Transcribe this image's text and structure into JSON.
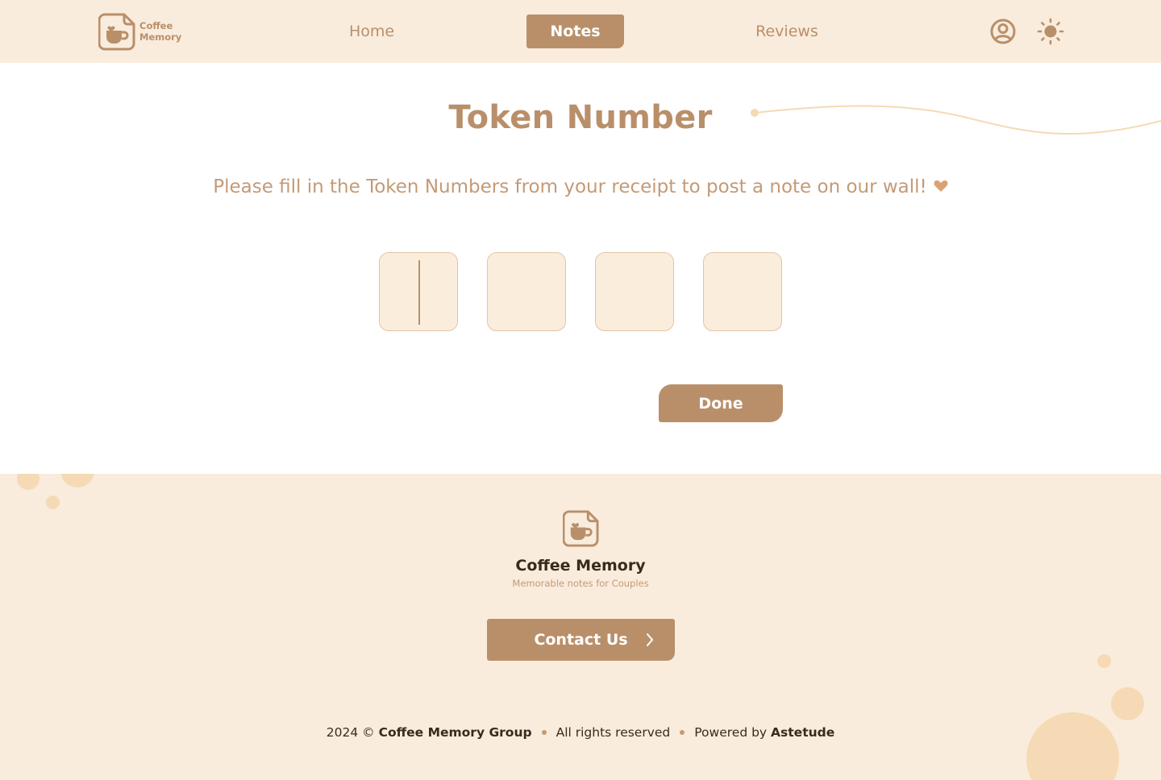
{
  "brand": {
    "name_line1": "Coffee",
    "name_line2": "Memory",
    "full_name": "Coffee Memory",
    "tagline": "Memorable notes for Couples"
  },
  "nav": {
    "items": [
      {
        "label": "Home",
        "active": false
      },
      {
        "label": "Notes",
        "active": true
      },
      {
        "label": "Reviews",
        "active": false
      }
    ],
    "icons": [
      "user-icon",
      "sun-icon"
    ]
  },
  "main": {
    "title": "Token Number",
    "subtitle": "Please fill in the Token Numbers from your receipt to post a note on our wall!",
    "subtitle_icon": "heart-icon",
    "token_inputs": [
      "",
      "",
      "",
      ""
    ],
    "done_label": "Done"
  },
  "footer": {
    "contact_label": "Contact Us",
    "contact_icon": "chevron-right-icon",
    "year": "2024 ©",
    "group": "Coffee Memory Group",
    "rights": "All rights reserved",
    "powered_prefix": "Powered by",
    "powered_by": "Astetude"
  },
  "colors": {
    "accent": "#b98f6a",
    "background_tint": "#f9ecdc",
    "token_box": "#fbeddc",
    "circle": "#f5dab5",
    "heading_dark": "#3a2a1e"
  }
}
